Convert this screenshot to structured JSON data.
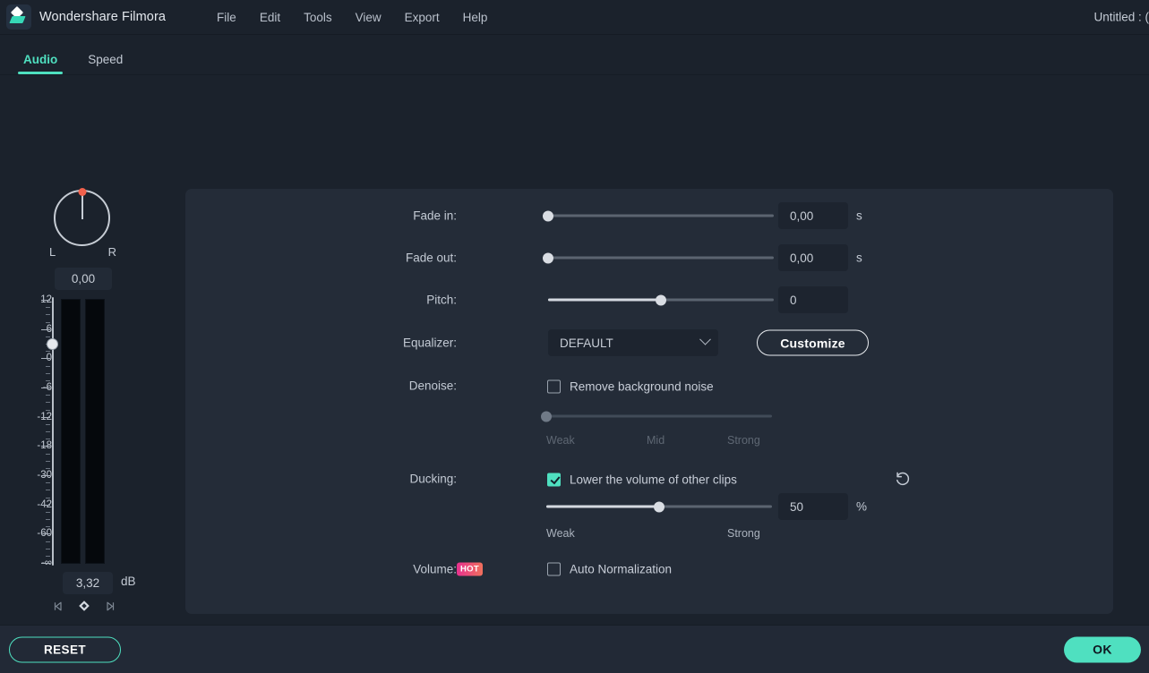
{
  "app": {
    "name": "Wondershare Filmora",
    "document_title": "Untitled : (",
    "logo_icon": "filmora-logo-icon",
    "accent_color": "#4fe0c0",
    "panel_bg": "#242c38",
    "page_bg": "#1b222c"
  },
  "menu": {
    "items": [
      {
        "label": "File"
      },
      {
        "label": "Edit"
      },
      {
        "label": "Tools"
      },
      {
        "label": "View"
      },
      {
        "label": "Export"
      },
      {
        "label": "Help"
      }
    ]
  },
  "tabs": [
    {
      "label": "Audio",
      "active": true
    },
    {
      "label": "Speed",
      "active": false
    }
  ],
  "meter": {
    "pan": {
      "value": "0,00",
      "left_label": "L",
      "right_label": "R",
      "knob_icon": "pan-knob-icon"
    },
    "scale_labels": [
      "12",
      "6",
      "0",
      "-6",
      "-12",
      "-18",
      "-30",
      "-42",
      "-60",
      "-∞"
    ],
    "volume_value": "3,32",
    "volume_unit": "dB",
    "keyframes": {
      "prev_icon": "prev-keyframe-icon",
      "add_icon": "add-keyframe-icon",
      "next_icon": "next-keyframe-icon"
    }
  },
  "settings": {
    "fade_in": {
      "label": "Fade in:",
      "value": "0,00",
      "unit": "s",
      "slider_percent": 0
    },
    "fade_out": {
      "label": "Fade out:",
      "value": "0,00",
      "unit": "s",
      "slider_percent": 0
    },
    "pitch": {
      "label": "Pitch:",
      "value": "0",
      "unit": "",
      "slider_percent": 50
    },
    "equalizer": {
      "label": "Equalizer:",
      "selected": "DEFAULT",
      "options": [
        "DEFAULT"
      ],
      "chevron_icon": "chevron-down-icon",
      "customize_label": "Customize"
    },
    "denoise": {
      "label": "Denoise:",
      "checkbox_label": "Remove background noise",
      "checked": false,
      "slider_percent": 0,
      "enabled": false,
      "tick_weak": "Weak",
      "tick_mid": "Mid",
      "tick_strong": "Strong"
    },
    "ducking": {
      "label": "Ducking:",
      "checkbox_label": "Lower the volume of other clips",
      "checked": true,
      "value": "50",
      "unit": "%",
      "slider_percent": 50,
      "tick_weak": "Weak",
      "tick_strong": "Strong",
      "reset_icon": "reset-arrow-icon"
    },
    "volume": {
      "badge": "HOT",
      "label": "Volume:",
      "checkbox_label": "Auto Normalization",
      "checked": false
    }
  },
  "footer": {
    "reset_label": "RESET",
    "ok_label": "OK"
  }
}
